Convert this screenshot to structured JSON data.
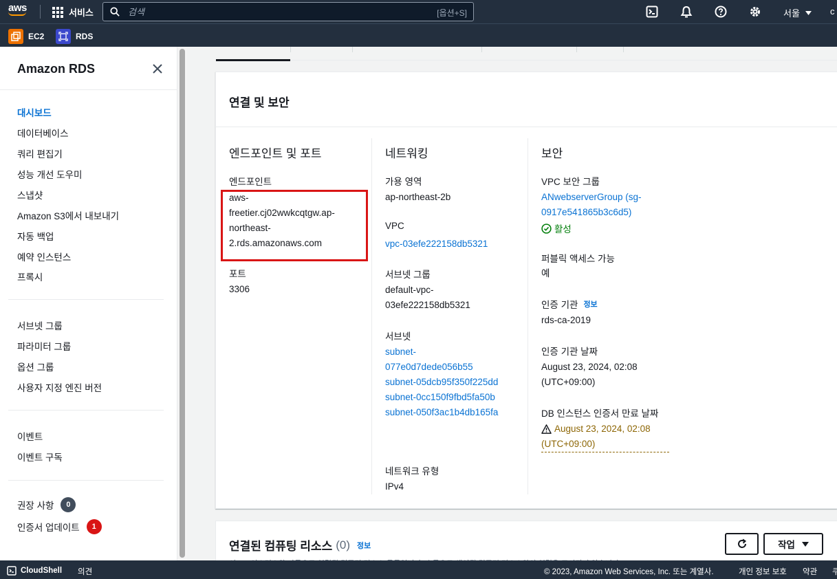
{
  "topnav": {
    "logo_text": "aws",
    "services_label": "서비스",
    "search_placeholder": "검색",
    "search_shortcut": "[옵션+S]",
    "region_label": "서울",
    "account_partial": "c"
  },
  "favorites": [
    {
      "label": "EC2",
      "color": "#ed7100"
    },
    {
      "label": "RDS",
      "color": "#3b48cc"
    }
  ],
  "sidebar": {
    "title": "Amazon RDS",
    "group1": [
      "대시보드",
      "데이터베이스",
      "쿼리 편집기",
      "성능 개선 도우미",
      "스냅샷",
      "Amazon S3에서 내보내기",
      "자동 백업",
      "예약 인스턴스",
      "프록시"
    ],
    "group2": [
      "서브넷 그룹",
      "파라미터 그룹",
      "옵션 그룹",
      "사용자 지정 엔진 버전"
    ],
    "group3": [
      "이벤트",
      "이벤트 구독"
    ],
    "recommendations": {
      "label": "권장 사항",
      "count": "0"
    },
    "cert_update": {
      "label": "인증서 업데이트",
      "count": "1"
    }
  },
  "connectivity": {
    "title": "연결 및 보안",
    "endpoint_col": {
      "title": "엔드포인트 및 포트",
      "endpoint_key": "엔드포인트",
      "endpoint_lines": [
        "aws-",
        "freetier.cj02wwkcqtgw.ap-",
        "northeast-",
        "2.rds.amazonaws.com"
      ],
      "port_key": "포트",
      "port_value": "3306"
    },
    "network_col": {
      "title": "네트워킹",
      "az_key": "가용 영역",
      "az_value": "ap-northeast-2b",
      "vpc_key": "VPC",
      "vpc_value": "vpc-03efe222158db5321",
      "subnet_group_key": "서브넷 그룹",
      "subnet_group_lines": [
        "default-vpc-",
        "03efe222158db5321"
      ],
      "subnets_key": "서브넷",
      "subnets": [
        "subnet-",
        "077e0d7dede056b55",
        "subnet-05dcb95f350f225dd",
        "subnet-0cc150f9fbd5fa50b",
        "subnet-050f3ac1b4db165fa"
      ],
      "network_type_key": "네트워크 유형",
      "network_type_value": "IPv4"
    },
    "security_col": {
      "title": "보안",
      "sg_key": "VPC 보안 그룹",
      "sg_lines": [
        "ANwebserverGroup (sg-",
        "0917e541865b3c6d5)"
      ],
      "sg_status": "활성",
      "public_key": "퍼블릭 액세스 가능",
      "public_value": "예",
      "ca_key": "인증 기관",
      "ca_info": "정보",
      "ca_value": "rds-ca-2019",
      "ca_date_key": "인증 기관 날짜",
      "ca_date_lines": [
        "August 23, 2024, 02:08",
        "(UTC+09:00)"
      ],
      "cert_expiry_key": "DB 인스턴스 인증서 만료 날짜",
      "cert_expiry_lines": [
        "August 23, 2024, 02:08",
        "(UTC+09:00)"
      ]
    }
  },
  "compute": {
    "title": "연결된 컴퓨팅 리소스",
    "count": "(0)",
    "info": "정보",
    "actions_label": "작업",
    "description": "이 DB 인스턴스와 자동으로 연결된 컴퓨팅 리소스 목록입니다. 수동으로 생성된 컴퓨팅 리소스와의 연결은 표시되지 않습니다."
  },
  "footer": {
    "cloudshell": "CloudShell",
    "feedback": "의견",
    "copyright": "© 2023, Amazon Web Services, Inc. 또는 계열사.",
    "privacy": "개인 정보 보호",
    "terms": "약관",
    "cookie_partial": "쿠"
  },
  "colors": {
    "nav_bg": "#232f3e",
    "link": "#0972d3",
    "success": "#037f0c",
    "warning": "#8d6605",
    "highlight": "#d91515"
  }
}
